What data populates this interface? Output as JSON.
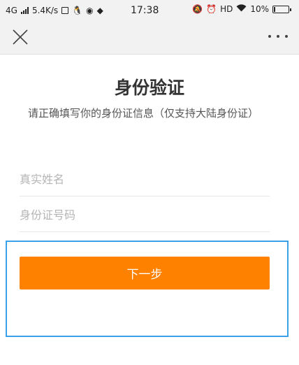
{
  "status_bar": {
    "network": "4G",
    "speed": "5.4K/s",
    "time": "17:38",
    "hd": "HD",
    "battery": "10%",
    "battery_level": 0.1
  },
  "nav": {
    "close_icon": "close-icon",
    "more_icon": "more-icon"
  },
  "content": {
    "title": "身份验证",
    "subtitle": "请正确填写你的身份证信息（仅支持大陆身份证）",
    "name_placeholder": "真实姓名",
    "id_placeholder": "身份证号码",
    "next_label": "下一步"
  },
  "colors": {
    "accent": "#ff8100",
    "highlight": "#3aa0e8"
  }
}
